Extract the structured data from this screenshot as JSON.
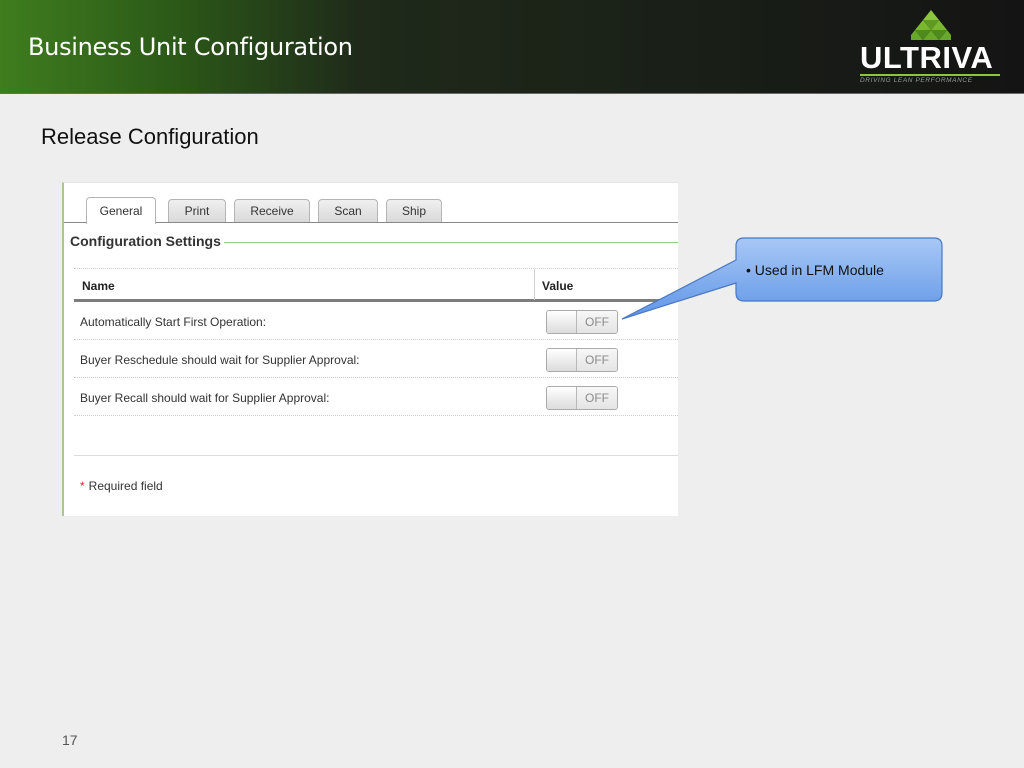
{
  "header": {
    "title": "Business Unit Configuration",
    "logo": {
      "name": "ULTRIVA",
      "tagline": "DRIVING LEAN PERFORMANCE",
      "mark_icon": "triangle-grid-logo-mark"
    }
  },
  "subtitle": "Release Configuration",
  "tabs": [
    {
      "label": "General",
      "active": true
    },
    {
      "label": "Print",
      "active": false
    },
    {
      "label": "Receive",
      "active": false
    },
    {
      "label": "Scan",
      "active": false
    },
    {
      "label": "Ship",
      "active": false
    }
  ],
  "section": {
    "title": "Configuration Settings"
  },
  "table": {
    "columns": [
      "Name",
      "Value"
    ],
    "rows": [
      {
        "name": "Automatically Start First Operation:",
        "value": "OFF"
      },
      {
        "name": "Buyer Reschedule should wait for Supplier Approval:",
        "value": "OFF"
      },
      {
        "name": "Buyer Recall should wait for Supplier Approval:",
        "value": "OFF"
      }
    ]
  },
  "footer": {
    "required_marker": "*",
    "required_text": "Required field"
  },
  "callout": {
    "text": "• Used in LFM Module"
  },
  "slide": {
    "page_number": "17"
  },
  "colors": {
    "brand_green": "#8cc63f",
    "header_dark": "#141414",
    "callout_blue": "#6fa3ea",
    "required_red": "#d9262e"
  }
}
